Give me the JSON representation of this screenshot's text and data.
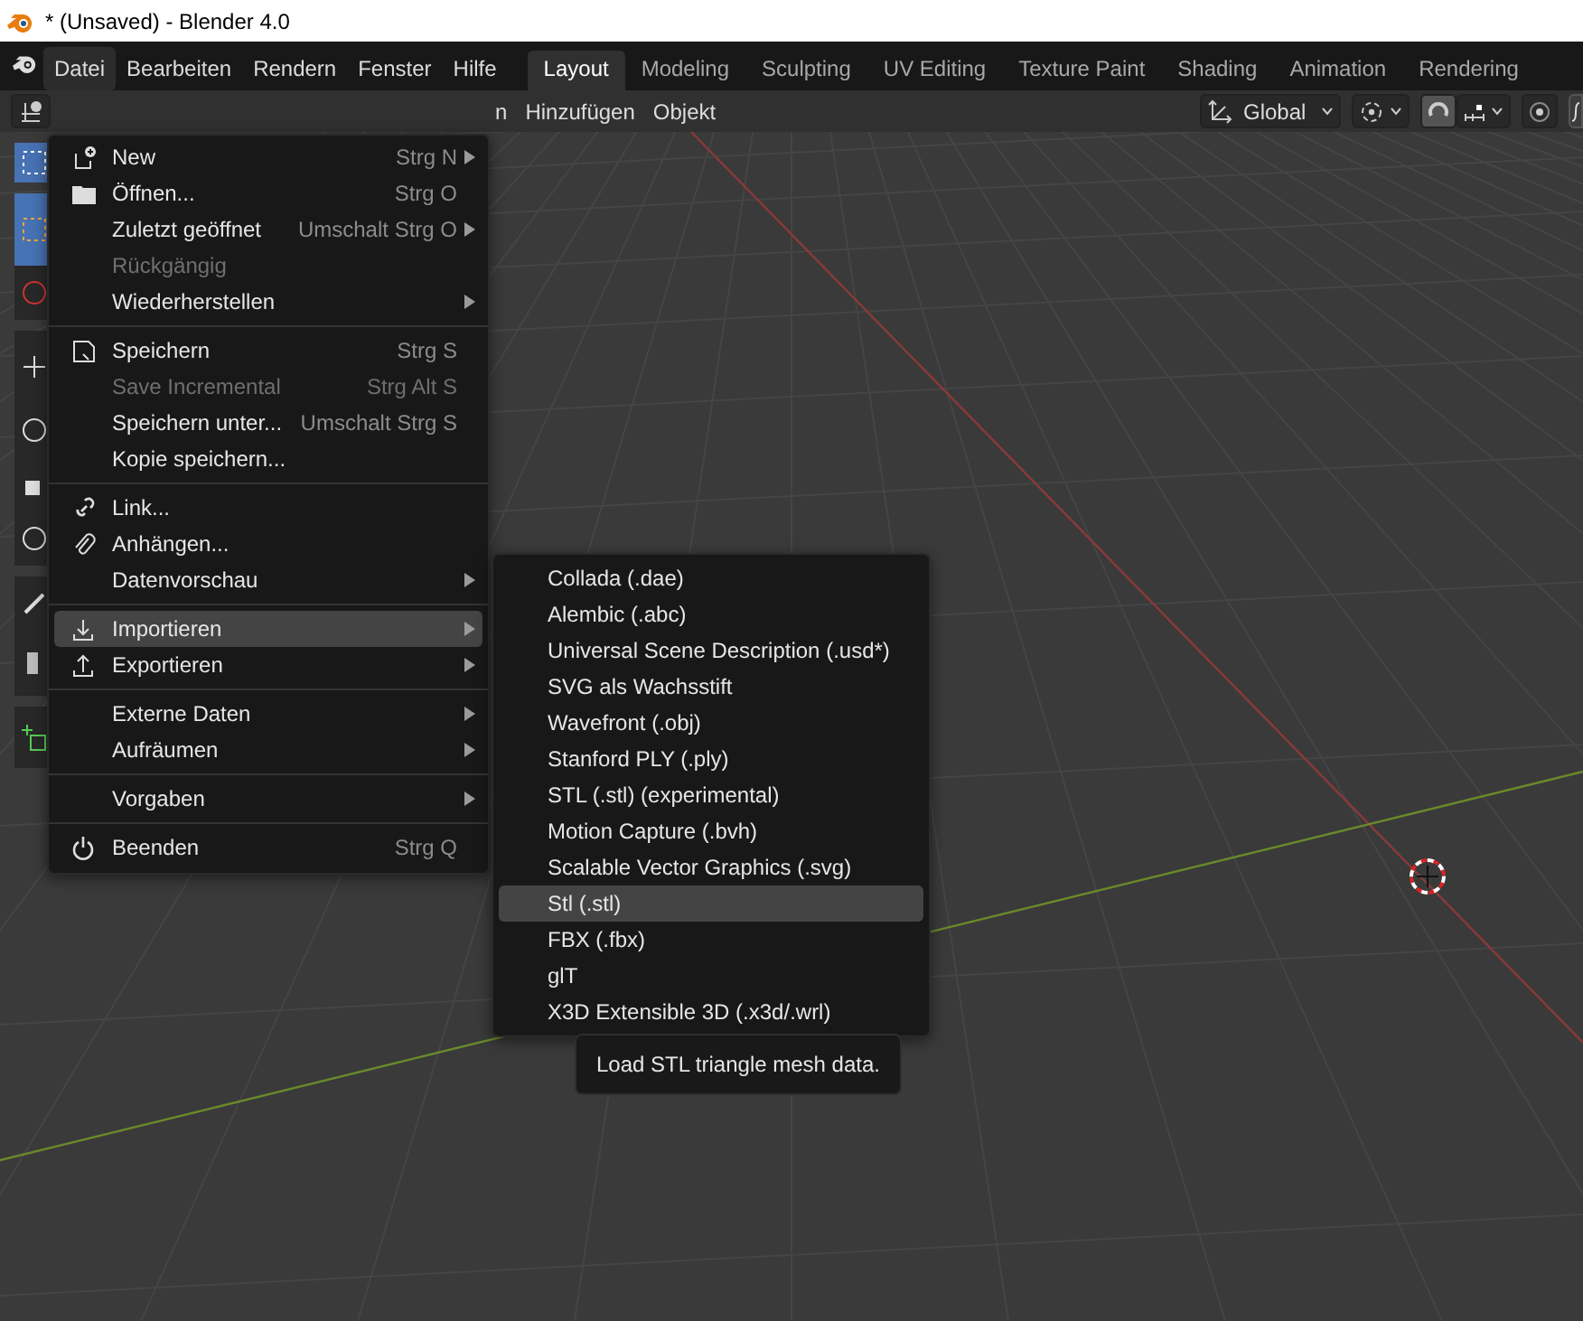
{
  "window": {
    "title": "* (Unsaved) - Blender 4.0"
  },
  "menubar": [
    {
      "label": "Datei",
      "selected": true
    },
    {
      "label": "Bearbeiten",
      "selected": false
    },
    {
      "label": "Rendern",
      "selected": false
    },
    {
      "label": "Fenster",
      "selected": false
    },
    {
      "label": "Hilfe",
      "selected": false
    }
  ],
  "workspace_tabs": [
    {
      "label": "Layout",
      "selected": true
    },
    {
      "label": "Modeling",
      "selected": false
    },
    {
      "label": "Sculpting",
      "selected": false
    },
    {
      "label": "UV Editing",
      "selected": false
    },
    {
      "label": "Texture Paint",
      "selected": false
    },
    {
      "label": "Shading",
      "selected": false
    },
    {
      "label": "Animation",
      "selected": false
    },
    {
      "label": "Rendering",
      "selected": false
    }
  ],
  "viewport_header": {
    "menus": [
      "n",
      "Hinzufügen",
      "Objekt"
    ],
    "transform_orientation": "Global",
    "snap": {
      "on": true
    }
  },
  "file_menu": [
    [
      {
        "label": "New",
        "shortcut": "Strg N",
        "submenu": true,
        "disabled": false,
        "selected": false
      },
      {
        "label": "Öffnen...",
        "shortcut": "Strg O",
        "submenu": false,
        "disabled": false,
        "selected": false
      },
      {
        "label": "Zuletzt geöffnet",
        "shortcut": "Umschalt Strg O",
        "submenu": true,
        "disabled": false,
        "selected": false
      },
      {
        "label": "Rückgängig",
        "submenu": false,
        "disabled": true,
        "selected": false
      },
      {
        "label": "Wiederherstellen",
        "submenu": true,
        "disabled": false,
        "selected": false
      }
    ],
    [
      {
        "label": "Speichern",
        "shortcut": "Strg S",
        "submenu": false,
        "disabled": false,
        "selected": false
      },
      {
        "label": "Save Incremental",
        "shortcut": "Strg Alt S",
        "submenu": false,
        "disabled": true,
        "selected": false
      },
      {
        "label": "Speichern unter...",
        "shortcut": "Umschalt Strg S",
        "submenu": false,
        "disabled": false,
        "selected": false
      },
      {
        "label": "Kopie speichern...",
        "submenu": false,
        "disabled": false,
        "selected": false
      }
    ],
    [
      {
        "label": "Link...",
        "submenu": false,
        "disabled": false,
        "selected": false
      },
      {
        "label": "Anhängen...",
        "submenu": false,
        "disabled": false,
        "selected": false
      },
      {
        "label": "Datenvorschau",
        "submenu": true,
        "disabled": false,
        "selected": false
      }
    ],
    [
      {
        "label": "Importieren",
        "submenu": true,
        "disabled": false,
        "selected": true
      },
      {
        "label": "Exportieren",
        "submenu": true,
        "disabled": false,
        "selected": false
      }
    ],
    [
      {
        "label": "Externe Daten",
        "submenu": true,
        "disabled": false,
        "selected": false
      },
      {
        "label": "Aufräumen",
        "submenu": true,
        "disabled": false,
        "selected": false
      }
    ],
    [
      {
        "label": "Vorgaben",
        "submenu": true,
        "disabled": false,
        "selected": false
      }
    ],
    [
      {
        "label": "Beenden",
        "shortcut": "Strg Q",
        "submenu": false,
        "disabled": false,
        "selected": false
      }
    ]
  ],
  "import_submenu": [
    {
      "label": "Collada (.dae)",
      "selected": false
    },
    {
      "label": "Alembic (.abc)",
      "selected": false
    },
    {
      "label": "Universal Scene Description (.usd*)",
      "selected": false
    },
    {
      "label": "SVG als Wachsstift",
      "selected": false
    },
    {
      "label": "Wavefront (.obj)",
      "selected": false
    },
    {
      "label": "Stanford PLY (.ply)",
      "selected": false
    },
    {
      "label": "STL (.stl) (experimental)",
      "selected": false
    },
    {
      "label": "Motion Capture (.bvh)",
      "selected": false
    },
    {
      "label": "Scalable Vector Graphics (.svg)",
      "selected": false
    },
    {
      "label": "Stl (.stl)",
      "selected": true
    },
    {
      "label": "FBX (.fbx)",
      "selected": false
    },
    {
      "label": "glT",
      "selected": false
    },
    {
      "label": "X3D Extensible 3D (.x3d/.wrl)",
      "selected": false
    }
  ],
  "tooltip": "Load STL triangle mesh data."
}
